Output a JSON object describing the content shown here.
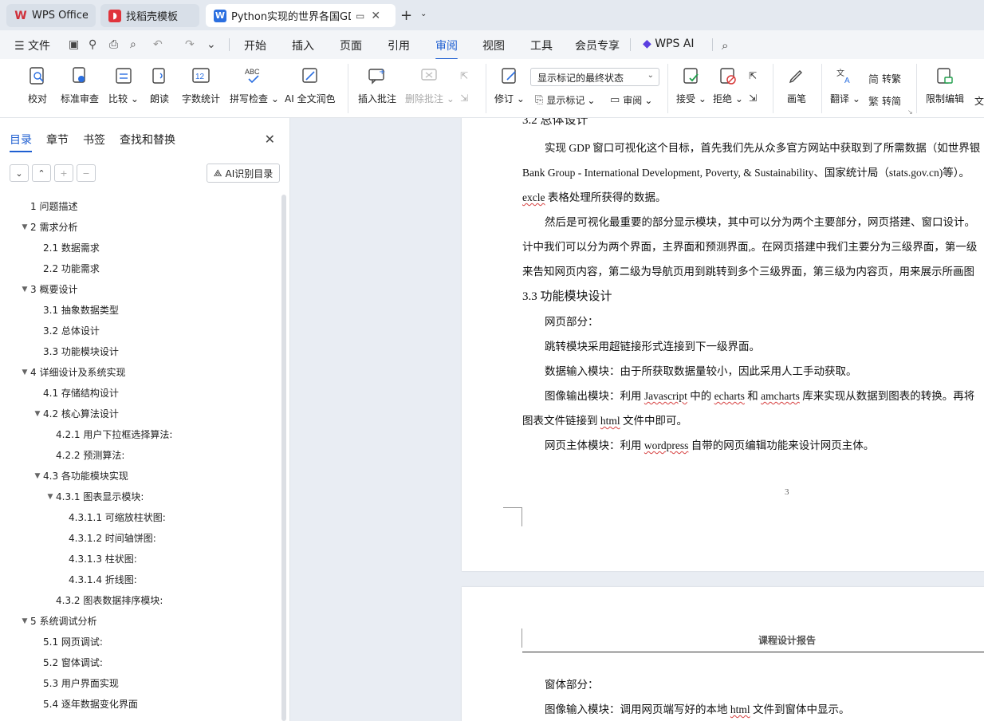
{
  "tabs": [
    {
      "label": "WPS Office",
      "icon": "wps-logo-icon"
    },
    {
      "label": "找稻壳模板",
      "icon": "daoke-logo-icon"
    },
    {
      "label": "Python实现的世界各国GDP和",
      "icon": "word-doc-icon",
      "active": true
    }
  ],
  "menu": {
    "file": "文件",
    "items": [
      "开始",
      "插入",
      "页面",
      "引用",
      "审阅",
      "视图",
      "工具",
      "会员专享"
    ],
    "active": "审阅",
    "wps_ai": "WPS AI"
  },
  "ribbon": {
    "proofread": "校对",
    "standard_review": "标准审查",
    "compare": "比较",
    "read_aloud": "朗读",
    "word_count": "字数统计",
    "spell_check": "拼写检查",
    "ai_polish": "AI 全文润色",
    "insert_comment": "插入批注",
    "delete_comment": "删除批注",
    "revise": "修订",
    "show_markup_select": "显示标记的最终状态",
    "show_markup": "显示标记",
    "review": "审阅",
    "accept": "接受",
    "reject": "拒绝",
    "pen": "画笔",
    "translate": "翻译",
    "to_traditional": "转繁",
    "to_simplified": "转简",
    "restrict_edit": "限制编辑",
    "doc_truncated": "文"
  },
  "panel": {
    "tabs": [
      "目录",
      "章节",
      "书签",
      "查找和替换"
    ],
    "ai_button": "AI识别目录",
    "toc": [
      {
        "text": "1  问题描述",
        "level": 1,
        "tri": ""
      },
      {
        "text": "2  需求分析",
        "level": 1,
        "tri": "▼"
      },
      {
        "text": "2.1  数据需求",
        "level": 2,
        "tri": ""
      },
      {
        "text": "2.2  功能需求",
        "level": 2,
        "tri": ""
      },
      {
        "text": "3  概要设计",
        "level": 1,
        "tri": "▼"
      },
      {
        "text": "3.1 抽象数据类型",
        "level": 2,
        "tri": ""
      },
      {
        "text": "3.2  总体设计",
        "level": 2,
        "tri": ""
      },
      {
        "text": "3.3  功能模块设计",
        "level": 2,
        "tri": ""
      },
      {
        "text": "4  详细设计及系统实现",
        "level": 1,
        "tri": "▼"
      },
      {
        "text": "4.1  存储结构设计",
        "level": 2,
        "tri": ""
      },
      {
        "text": "4.2  核心算法设计",
        "level": 2,
        "tri": "▼"
      },
      {
        "text": "4.2.1 用户下拉框选择算法:",
        "level": 3,
        "tri": ""
      },
      {
        "text": "4.2.2 预测算法:",
        "level": 3,
        "tri": ""
      },
      {
        "text": "4.3  各功能模块实现",
        "level": 2,
        "tri": "▼"
      },
      {
        "text": "4.3.1 图表显示模块:",
        "level": 3,
        "tri": "▼"
      },
      {
        "text": "4.3.1.1 可缩放柱状图:",
        "level": 4,
        "tri": ""
      },
      {
        "text": "4.3.1.2 时间轴饼图:",
        "level": 4,
        "tri": ""
      },
      {
        "text": "4.3.1.3 柱状图:",
        "level": 4,
        "tri": ""
      },
      {
        "text": "4.3.1.4 折线图:",
        "level": 4,
        "tri": ""
      },
      {
        "text": "4.3.2 图表数据排序模块:",
        "level": 3,
        "tri": ""
      },
      {
        "text": "5  系统调试分析",
        "level": 1,
        "tri": "▼"
      },
      {
        "text": "5.1 网页调试:",
        "level": 2,
        "tri": ""
      },
      {
        "text": "5.2 窗体调试:",
        "level": 2,
        "tri": ""
      },
      {
        "text": "5.3 用户界面实现",
        "level": 2,
        "tri": ""
      },
      {
        "text": "5.4 逐年数据变化界面",
        "level": 2,
        "tri": ""
      }
    ]
  },
  "doc": {
    "section_heading_cut": "3.2  总体设计",
    "p1_l1": "实现 GDP 窗口可视化这个目标，首先我们先从众多官方网站中获取到了所需数据（如世界银",
    "p1_l2": "Bank Group - International Development, Poverty, & Sustainability、国家统计局（stats.gov.cn)等）。",
    "p1_l3a": "excle",
    "p1_l3b": " 表格处理所获得的数据。",
    "p2_l1": "然后是可视化最重要的部分显示模块，其中可以分为两个主要部分，网页搭建、窗口设计。",
    "p2_l2": "计中我们可以分为两个界面，主界面和预测界面,。在网页搭建中我们主要分为三级界面，第一级",
    "p2_l3": "来告知网页内容，第二级为导航页用到跳转到多个三级界面，第三级为内容页，用来展示所画图",
    "h33": "3.3  功能模块设计",
    "web_part": "网页部分：",
    "jump": "跳转模块采用超链接形式连接到下一级界面。",
    "data_input": "数据输入模块：由于所获取数据量较小，因此采用人工手动获取。",
    "img_out_a": "图像输出模块：利用 ",
    "img_out_js": "Javascript",
    "img_out_b": " 中的 ",
    "img_out_ec": "echarts",
    "img_out_c": " 和 ",
    "img_out_am": "amcharts",
    "img_out_d": " 库来实现从数据到图表的转换。再将",
    "img_out2_a": "图表文件链接到 ",
    "img_out2_html": "html",
    "img_out2_b": " 文件中即可。",
    "main_a": "网页主体模块：利用 ",
    "main_wp": "wordpress",
    "main_b": " 自带的网页编辑功能来设计网页主体。",
    "page_number": "3",
    "header_title": "课程设计报告",
    "form_part": "窗体部分：",
    "img_in_a": "图像输入模块：调用网页端写好的本地 ",
    "img_in_html": "html",
    "img_in_b": " 文件到窗体中显示。"
  }
}
